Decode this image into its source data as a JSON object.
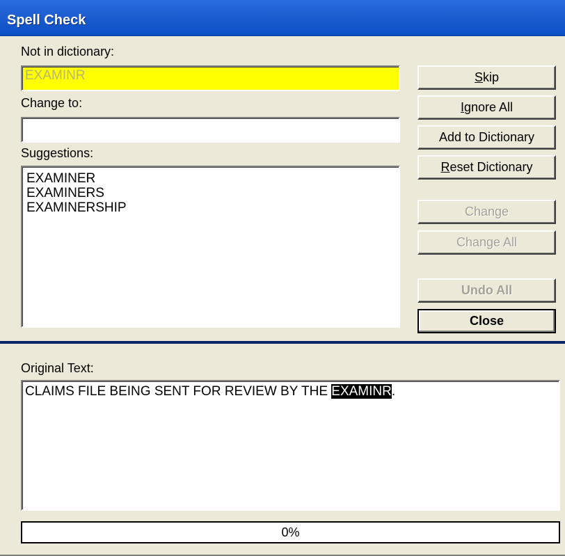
{
  "window": {
    "title": "Spell Check"
  },
  "labels": {
    "not_in_dictionary": "Not in dictionary:",
    "change_to": "Change to:",
    "suggestions": "Suggestions:",
    "original_text": "Original Text:"
  },
  "fields": {
    "not_in_dictionary_value": "EXAMINR",
    "change_to_value": ""
  },
  "suggestions": [
    "EXAMINER",
    "EXAMINERS",
    "EXAMINERSHIP"
  ],
  "buttons": {
    "skip": {
      "prefix": "",
      "accel": "S",
      "rest": "kip"
    },
    "ignore_all": {
      "prefix": "",
      "accel": "I",
      "rest": "gnore All"
    },
    "add_to_dictionary": "Add to Dictionary",
    "reset_dictionary": {
      "prefix": "",
      "accel": "R",
      "rest": "eset Dictionary"
    },
    "change": "Change",
    "change_all": "Change All",
    "undo_all": "Undo All",
    "close": "Close"
  },
  "original_text": {
    "before": "CLAIMS FILE BEING SENT FOR REVIEW BY THE ",
    "highlight": "EXAMINR",
    "after": "."
  },
  "progress": {
    "label": "0%",
    "value": 0
  },
  "colors": {
    "title_bar": "#1f5fd2",
    "not_in_dictionary_bg": "#ffff00",
    "divider": "#0a246a"
  }
}
